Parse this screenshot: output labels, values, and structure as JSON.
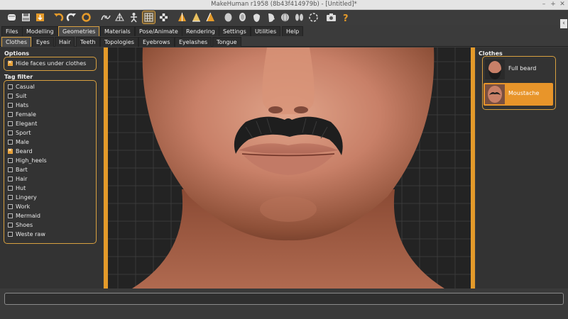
{
  "window": {
    "title": "MakeHuman r1958 (8b43f414979b) - [Untitled]*",
    "controls": [
      "–",
      "+",
      "✕"
    ]
  },
  "toolbar": {
    "buttons": [
      {
        "icon": "new-file-icon"
      },
      {
        "icon": "save-icon"
      },
      {
        "icon": "export-icon"
      },
      {
        "icon": "undo-icon"
      },
      {
        "icon": "redo-icon"
      },
      {
        "icon": "reset-icon"
      },
      {
        "icon": "smooth-icon"
      },
      {
        "icon": "wireframe-icon"
      },
      {
        "icon": "pose-icon"
      },
      {
        "icon": "grid-icon",
        "active": true
      },
      {
        "icon": "checker-icon"
      },
      {
        "icon": "front-view-icon"
      },
      {
        "icon": "back-view-icon"
      },
      {
        "icon": "left-view-icon"
      },
      {
        "icon": "skin-icon"
      },
      {
        "icon": "head-icon"
      },
      {
        "icon": "face-icon"
      },
      {
        "icon": "profile-icon"
      },
      {
        "icon": "global-icon"
      },
      {
        "icon": "symmetry-icon"
      },
      {
        "icon": "reset-camera-icon"
      },
      {
        "icon": "screenshot-icon"
      },
      {
        "icon": "help-icon"
      }
    ]
  },
  "menu": {
    "tabs": [
      "Files",
      "Modelling",
      "Geometries",
      "Materials",
      "Pose/Animate",
      "Rendering",
      "Settings",
      "Utilities",
      "Help"
    ],
    "active": "Geometries"
  },
  "submenu": {
    "tabs": [
      "Clothes",
      "Eyes",
      "Hair",
      "Teeth",
      "Topologies",
      "Eyebrows",
      "Eyelashes",
      "Tongue"
    ],
    "active": "Clothes"
  },
  "options": {
    "title": "Options",
    "hide_faces": {
      "label": "Hide faces under clothes",
      "checked": true
    }
  },
  "tag_filter": {
    "title": "Tag filter",
    "tags": [
      {
        "label": "Casual",
        "checked": false
      },
      {
        "label": "Suit",
        "checked": false
      },
      {
        "label": "Hats",
        "checked": false
      },
      {
        "label": "Female",
        "checked": false
      },
      {
        "label": "Elegant",
        "checked": false
      },
      {
        "label": "Sport",
        "checked": false
      },
      {
        "label": "Male",
        "checked": false
      },
      {
        "label": "Beard",
        "checked": true
      },
      {
        "label": "High_heels",
        "checked": false
      },
      {
        "label": "Bart",
        "checked": false
      },
      {
        "label": "Hair",
        "checked": false
      },
      {
        "label": "Hut",
        "checked": false
      },
      {
        "label": "Lingery",
        "checked": false
      },
      {
        "label": "Work",
        "checked": false
      },
      {
        "label": "Mermaid",
        "checked": false
      },
      {
        "label": "Shoes",
        "checked": false
      },
      {
        "label": "Weste raw",
        "checked": false
      }
    ]
  },
  "clothes": {
    "title": "Clothes",
    "items": [
      {
        "label": "Full beard",
        "selected": false
      },
      {
        "label": "Moustache",
        "selected": true
      }
    ]
  },
  "colors": {
    "accent": "#e49a2a",
    "panel": "#333333",
    "background": "#3b3b3b"
  },
  "bottom": {
    "arrow": "‹"
  }
}
